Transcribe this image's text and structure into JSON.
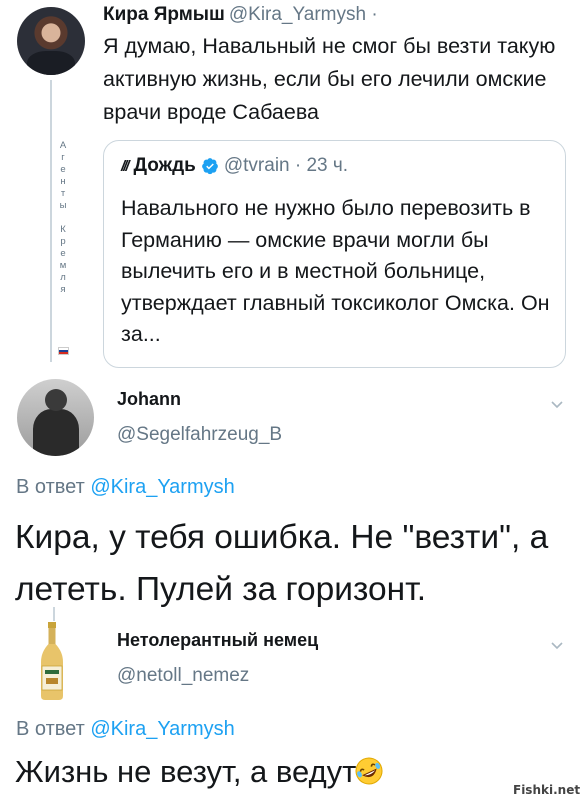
{
  "tweet1": {
    "name": "Кира Ярмыш",
    "handle": "@Kira_Yarmysh ·",
    "text": "Я думаю, Навальный не смог бы везти такую активную жизнь, если бы его лечили омские врачи вроде Сабаева",
    "side_label": [
      "А",
      "г",
      "е",
      "н",
      "т",
      "ы",
      " ",
      "К",
      "р",
      "е",
      "м",
      "л",
      "я"
    ],
    "quote": {
      "logo": "///",
      "name": "Дождь",
      "handle": "@tvrain · 23 ч.",
      "text": "Навального не нужно было перевозить в Германию — омские врачи могли бы вылечить его и в местной больнице, утверждает главный токсиколог Омска. Он за..."
    }
  },
  "tweet2": {
    "name": "Johann",
    "handle": "@Segelfahrzeug_B",
    "reply_prefix": "В ответ",
    "reply_to": "@Kira_Yarmysh",
    "text": "Кира, у тебя ошибка. Не \"везти\", а лететь. Пулей за горизонт."
  },
  "tweet3": {
    "name": "Нетолерантный немец",
    "handle": "@netoll_nemez",
    "reply_prefix": "В ответ",
    "reply_to": "@Kira_Yarmysh",
    "text": "Жизнь не везут, а ведут"
  },
  "watermark": "Fishki.net",
  "icons": {
    "verified": "verified-badge-icon",
    "more": "chevron-down-icon",
    "emoji": "rolling-on-floor-laughing-emoji"
  },
  "colors": {
    "link": "#1da1f2",
    "secondary_text": "#657786",
    "primary_text": "#14171a",
    "verified": "#1da1f2"
  }
}
